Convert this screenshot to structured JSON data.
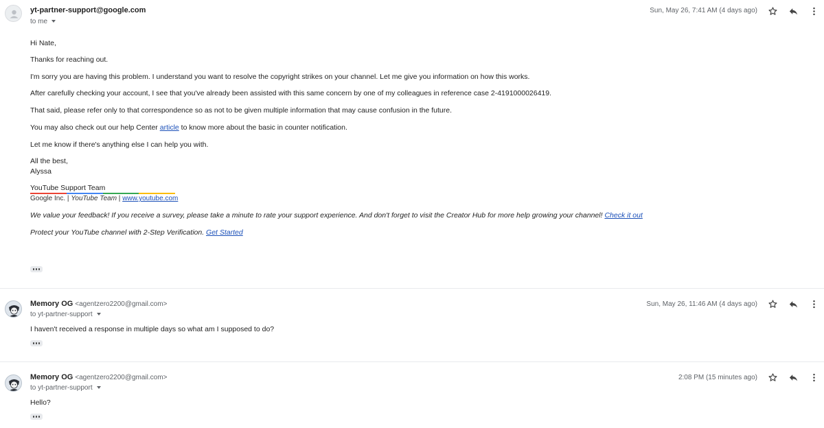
{
  "messages": [
    {
      "sender_name": "yt-partner-support@google.com",
      "sender_email": "",
      "to": "to me",
      "date": "Sun, May 26, 7:41 AM (4 days ago)",
      "avatar": "generic-person-icon",
      "body": {
        "greeting": "Hi Nate,",
        "p1": "Thanks for reaching out.",
        "p2": "I'm sorry you are having this problem. I understand you want to resolve the copyright strikes on your channel. Let me give you information on how this works.",
        "p3": "After carefully checking your account, I see that you've already been assisted with this same concern by one of my colleagues in reference case 2-4191000026419.",
        "p4": "That said, please refer only to that correspondence so as not to be given multiple information that may cause confusion in the future.",
        "p5_before": "You may also check out our help Center ",
        "p5_link": "article",
        "p5_after": " to know more about the basic in counter notification.",
        "p6": "Let me know if there's anything else I can help you with.",
        "closing": "All the best,",
        "name": "Alyssa",
        "sig_team": "YouTube Support Team",
        "sig_company": "Google Inc.",
        "sig_sep1": " | ",
        "sig_role": "YouTube Team",
        "sig_sep2": " | ",
        "sig_link": "www.youtube.com",
        "feedback_text": "We value your feedback! If you receive a survey, please take a minute to rate your support experience. And don't forget to visit the Creator Hub for more help growing your channel! ",
        "feedback_link": "Check it out",
        "protect_text": "Protect your YouTube channel with 2-Step Verification. ",
        "protect_link": "Get Started"
      }
    },
    {
      "sender_name": "Memory OG",
      "sender_email": "<agentzero2200@gmail.com>",
      "to": "to yt-partner-support",
      "date": "Sun, May 26, 11:46 AM (4 days ago)",
      "avatar": "memory-og-avatar",
      "body": {
        "p1": "I haven't received a response in multiple days so what am I supposed to do?"
      }
    },
    {
      "sender_name": "Memory OG",
      "sender_email": "<agentzero2200@gmail.com>",
      "to": "to yt-partner-support",
      "date": "2:08 PM (15 minutes ago)",
      "avatar": "memory-og-avatar",
      "body": {
        "p1": "Hello?"
      }
    }
  ],
  "icons": {
    "star": "star-icon",
    "reply": "reply-icon",
    "more": "more-vert-icon",
    "ellipsis": "show-trimmed-content-icon",
    "caret": "chevron-down-icon"
  },
  "colors": {
    "link": "#1a4fb8",
    "signature_bar": [
      "#ea4335",
      "#4285f4",
      "#34a853",
      "#fbbc04"
    ]
  }
}
